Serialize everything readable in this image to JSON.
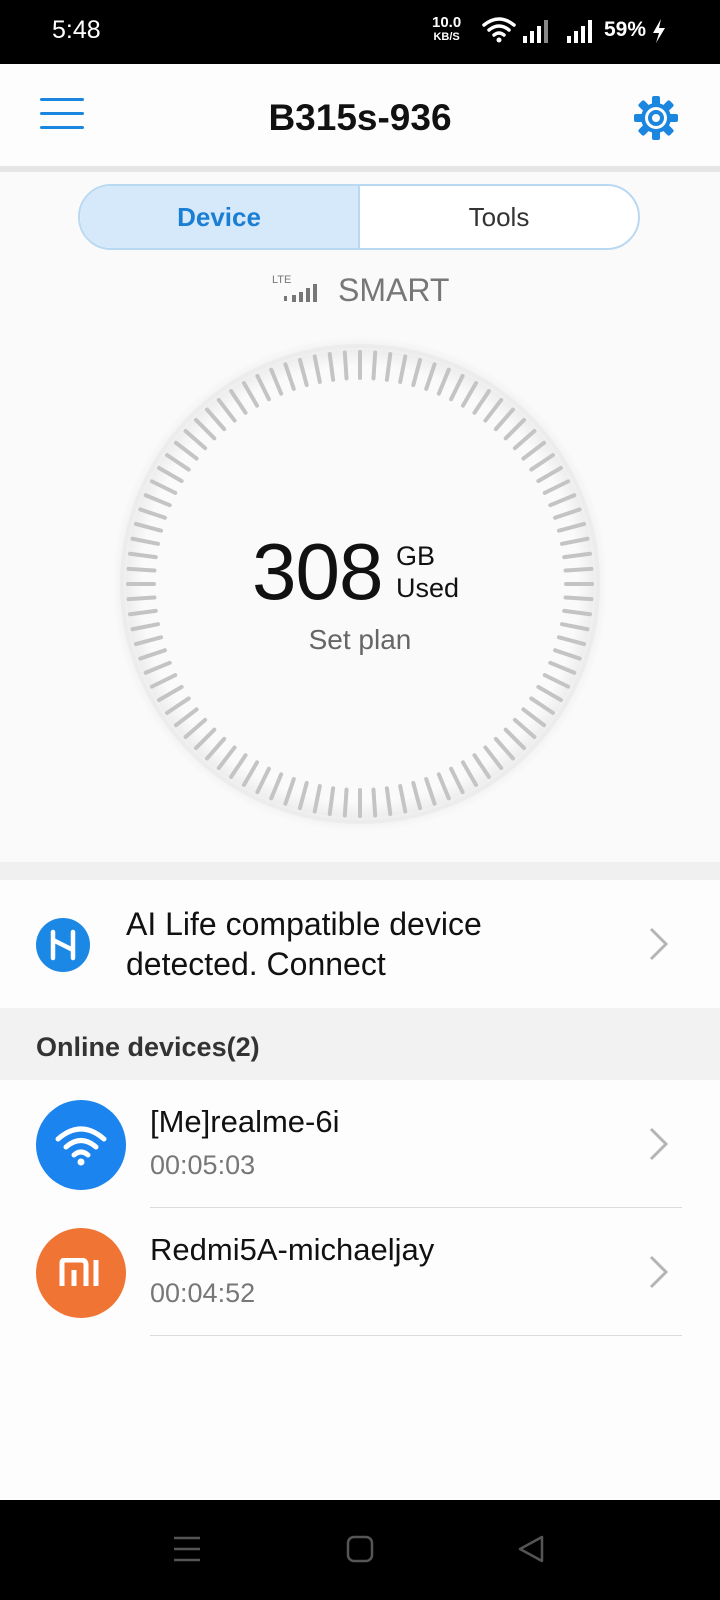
{
  "status_bar": {
    "time": "5:48",
    "net_speed_value": "10.0",
    "net_speed_unit": "KB/S",
    "battery": "59%"
  },
  "header": {
    "title": "B315s-936",
    "accent_color": "#1a86e0"
  },
  "tabs": [
    {
      "label": "Device",
      "active": true
    },
    {
      "label": "Tools",
      "active": false
    }
  ],
  "network": {
    "type": "LTE",
    "carrier": "SMART"
  },
  "usage": {
    "value": "308",
    "unit": "GB",
    "suffix": "Used",
    "plan_link": "Set plan"
  },
  "ai_life": {
    "message": "AI Life compatible device detected. Connect",
    "icon": "ai-life-icon"
  },
  "online_devices": {
    "title": "Online devices(2)",
    "items": [
      {
        "name": "[Me]realme-6i",
        "time": "00:05:03",
        "icon": "wifi-icon",
        "color": "#1b84ee"
      },
      {
        "name": "Redmi5A-michaeljay",
        "time": "00:04:52",
        "icon": "mi-logo-icon",
        "color": "#f07535"
      }
    ]
  }
}
